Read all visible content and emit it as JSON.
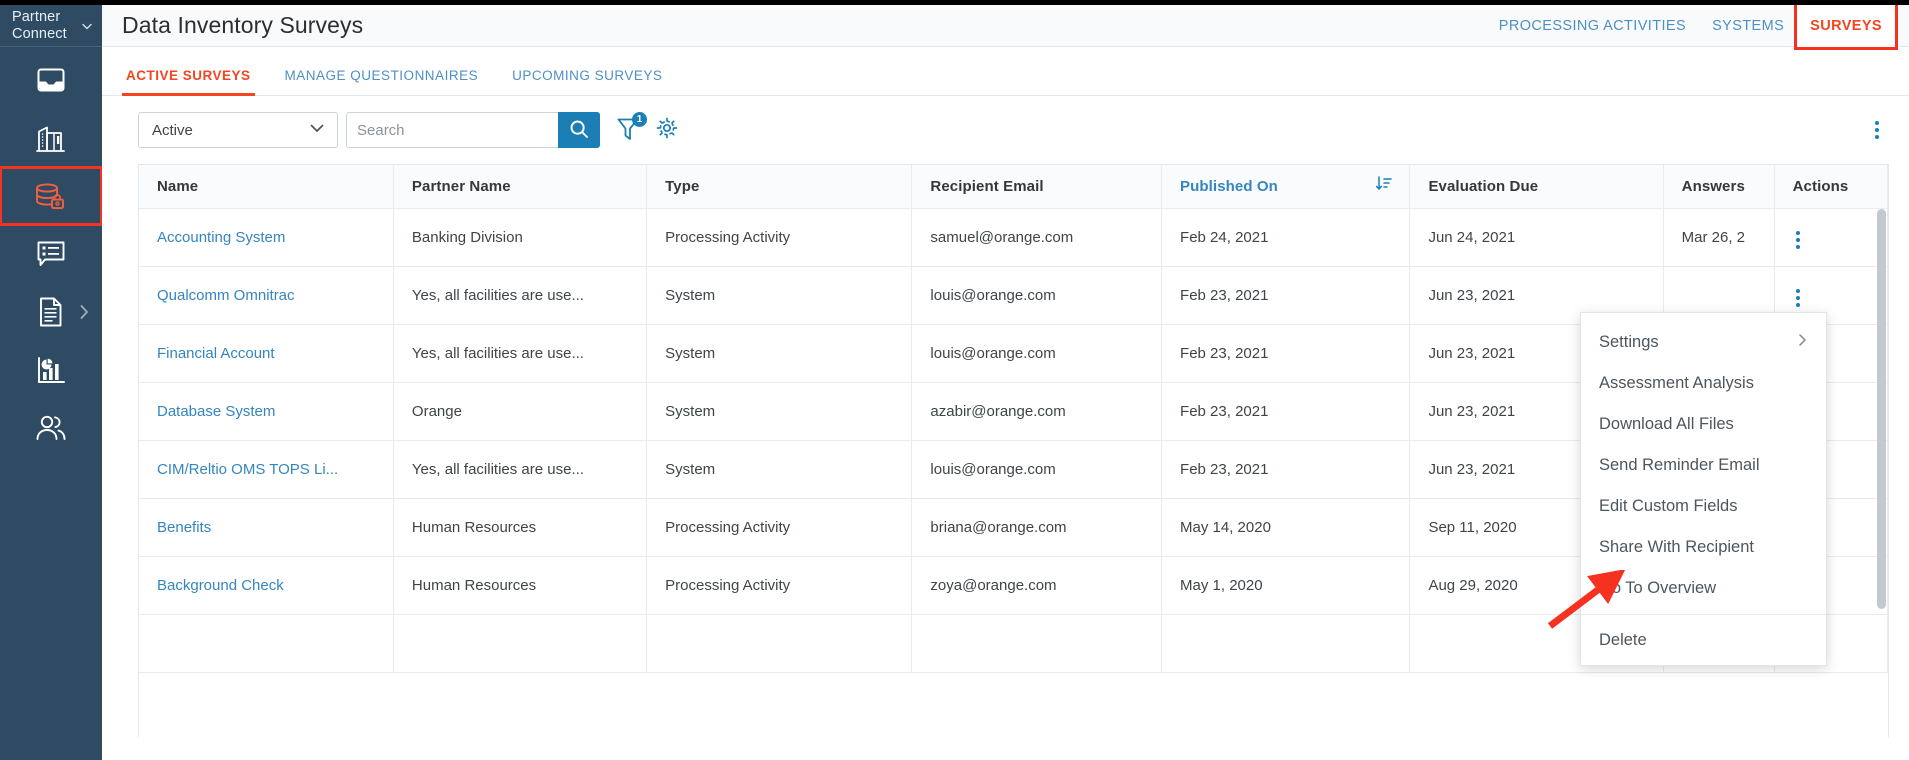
{
  "sidebar": {
    "brand": "Partner Connect",
    "brand_chevron_icon": "chevron-down-icon",
    "items": [
      {
        "name": "inbox",
        "icon": "inbox-icon",
        "selected": false,
        "has_submenu": false
      },
      {
        "name": "organization",
        "icon": "building-icon",
        "selected": false,
        "has_submenu": false
      },
      {
        "name": "data-inventory",
        "icon": "database-lock-icon",
        "selected": true,
        "has_submenu": false
      },
      {
        "name": "assessments",
        "icon": "comment-list-icon",
        "selected": false,
        "has_submenu": false
      },
      {
        "name": "documents",
        "icon": "document-icon",
        "selected": false,
        "has_submenu": true
      },
      {
        "name": "reports",
        "icon": "chart-bar-pie-icon",
        "selected": false,
        "has_submenu": false
      },
      {
        "name": "users",
        "icon": "people-icon",
        "selected": false,
        "has_submenu": false
      }
    ]
  },
  "header": {
    "title": "Data Inventory Surveys",
    "nav": [
      {
        "label": "PROCESSING ACTIVITIES",
        "active": false,
        "boxed": false
      },
      {
        "label": "SYSTEMS",
        "active": false,
        "boxed": false
      },
      {
        "label": "SURVEYS",
        "active": true,
        "boxed": true
      }
    ]
  },
  "tabs": [
    {
      "label": "ACTIVE SURVEYS",
      "active": true
    },
    {
      "label": "MANAGE QUESTIONNAIRES",
      "active": false
    },
    {
      "label": "UPCOMING SURVEYS",
      "active": false
    }
  ],
  "toolbar": {
    "status_filter": {
      "value": "Active",
      "chevron_icon": "chevron-down-icon"
    },
    "search": {
      "value": "",
      "placeholder": "Search",
      "button_icon": "search-icon"
    },
    "filter": {
      "icon": "funnel-icon",
      "badge": "1"
    },
    "settings": {
      "icon": "gear-icon"
    },
    "more": {
      "icon": "kebab-menu-icon"
    }
  },
  "table": {
    "columns": [
      {
        "label": "Name",
        "sortable": false
      },
      {
        "label": "Partner Name",
        "sortable": false
      },
      {
        "label": "Type",
        "sortable": false
      },
      {
        "label": "Recipient Email",
        "sortable": false
      },
      {
        "label": "Published On",
        "sortable": true,
        "sort_icon": "sort-descending-icon"
      },
      {
        "label": "Evaluation Due",
        "sortable": false
      },
      {
        "label": "Answers",
        "sortable": false
      },
      {
        "label": "Actions",
        "sortable": false
      }
    ],
    "rows": [
      {
        "name": "Accounting System",
        "partner_name": "Banking Division",
        "type": "Processing Activity",
        "recipient_email": "samuel@orange.com",
        "published_on": "Feb 24, 2021",
        "evaluation_due": "Jun 24, 2021",
        "answers": "Mar 26, 2",
        "actions_icon": "kebab-menu-icon"
      },
      {
        "name": "Qualcomm Omnitrac",
        "partner_name": "Yes, all facilities are use...",
        "type": "System",
        "recipient_email": "louis@orange.com",
        "published_on": "Feb 23, 2021",
        "evaluation_due": "Jun 23, 2021",
        "answers": "",
        "actions_icon": "kebab-menu-icon"
      },
      {
        "name": "Financial Account",
        "partner_name": "Yes, all facilities are use...",
        "type": "System",
        "recipient_email": "louis@orange.com",
        "published_on": "Feb 23, 2021",
        "evaluation_due": "Jun 23, 2021",
        "answers": "",
        "actions_icon": "kebab-menu-icon"
      },
      {
        "name": "Database System",
        "partner_name": "Orange",
        "type": "System",
        "recipient_email": "azabir@orange.com",
        "published_on": "Feb 23, 2021",
        "evaluation_due": "Jun 23, 2021",
        "answers": "",
        "actions_icon": "kebab-menu-icon"
      },
      {
        "name": "CIM/Reltio OMS TOPS Li...",
        "partner_name": "Yes, all facilities are use...",
        "type": "System",
        "recipient_email": "louis@orange.com",
        "published_on": "Feb 23, 2021",
        "evaluation_due": "Jun 23, 2021",
        "answers": "",
        "actions_icon": "kebab-menu-icon"
      },
      {
        "name": "Benefits",
        "partner_name": "Human Resources",
        "type": "Processing Activity",
        "recipient_email": "briana@orange.com",
        "published_on": "May 14, 2020",
        "evaluation_due": "Sep 11, 2020",
        "answers": "",
        "actions_icon": "kebab-menu-icon"
      },
      {
        "name": "Background Check",
        "partner_name": "Human Resources",
        "type": "Processing Activity",
        "recipient_email": "zoya@orange.com",
        "published_on": "May 1, 2020",
        "evaluation_due": "Aug 29, 2020",
        "answers": "",
        "actions_icon": "kebab-menu-icon"
      }
    ]
  },
  "context_menu": {
    "items": [
      {
        "label": "Settings",
        "has_submenu": true,
        "sub_arrow_icon": "chevron-right-icon"
      },
      {
        "label": "Assessment Analysis",
        "has_submenu": false
      },
      {
        "label": "Download All Files",
        "has_submenu": false
      },
      {
        "label": "Send Reminder Email",
        "has_submenu": false
      },
      {
        "label": "Edit Custom Fields",
        "has_submenu": false
      },
      {
        "label": "Share With Recipient",
        "has_submenu": false
      },
      {
        "label": "Go To Overview",
        "has_submenu": false
      }
    ],
    "footer_items": [
      {
        "label": "Delete",
        "has_submenu": false
      }
    ]
  },
  "annotation": {
    "arrow_icon": "red-arrow-icon",
    "points_to": "Share With Recipient"
  },
  "colors": {
    "sidebar_bg": "#2f4a63",
    "accent_red": "#f4451f",
    "highlight_red": "#f4321f",
    "link_blue": "#3585bf",
    "primary_blue": "#1b7fb5",
    "text_dark": "#3d4549"
  }
}
